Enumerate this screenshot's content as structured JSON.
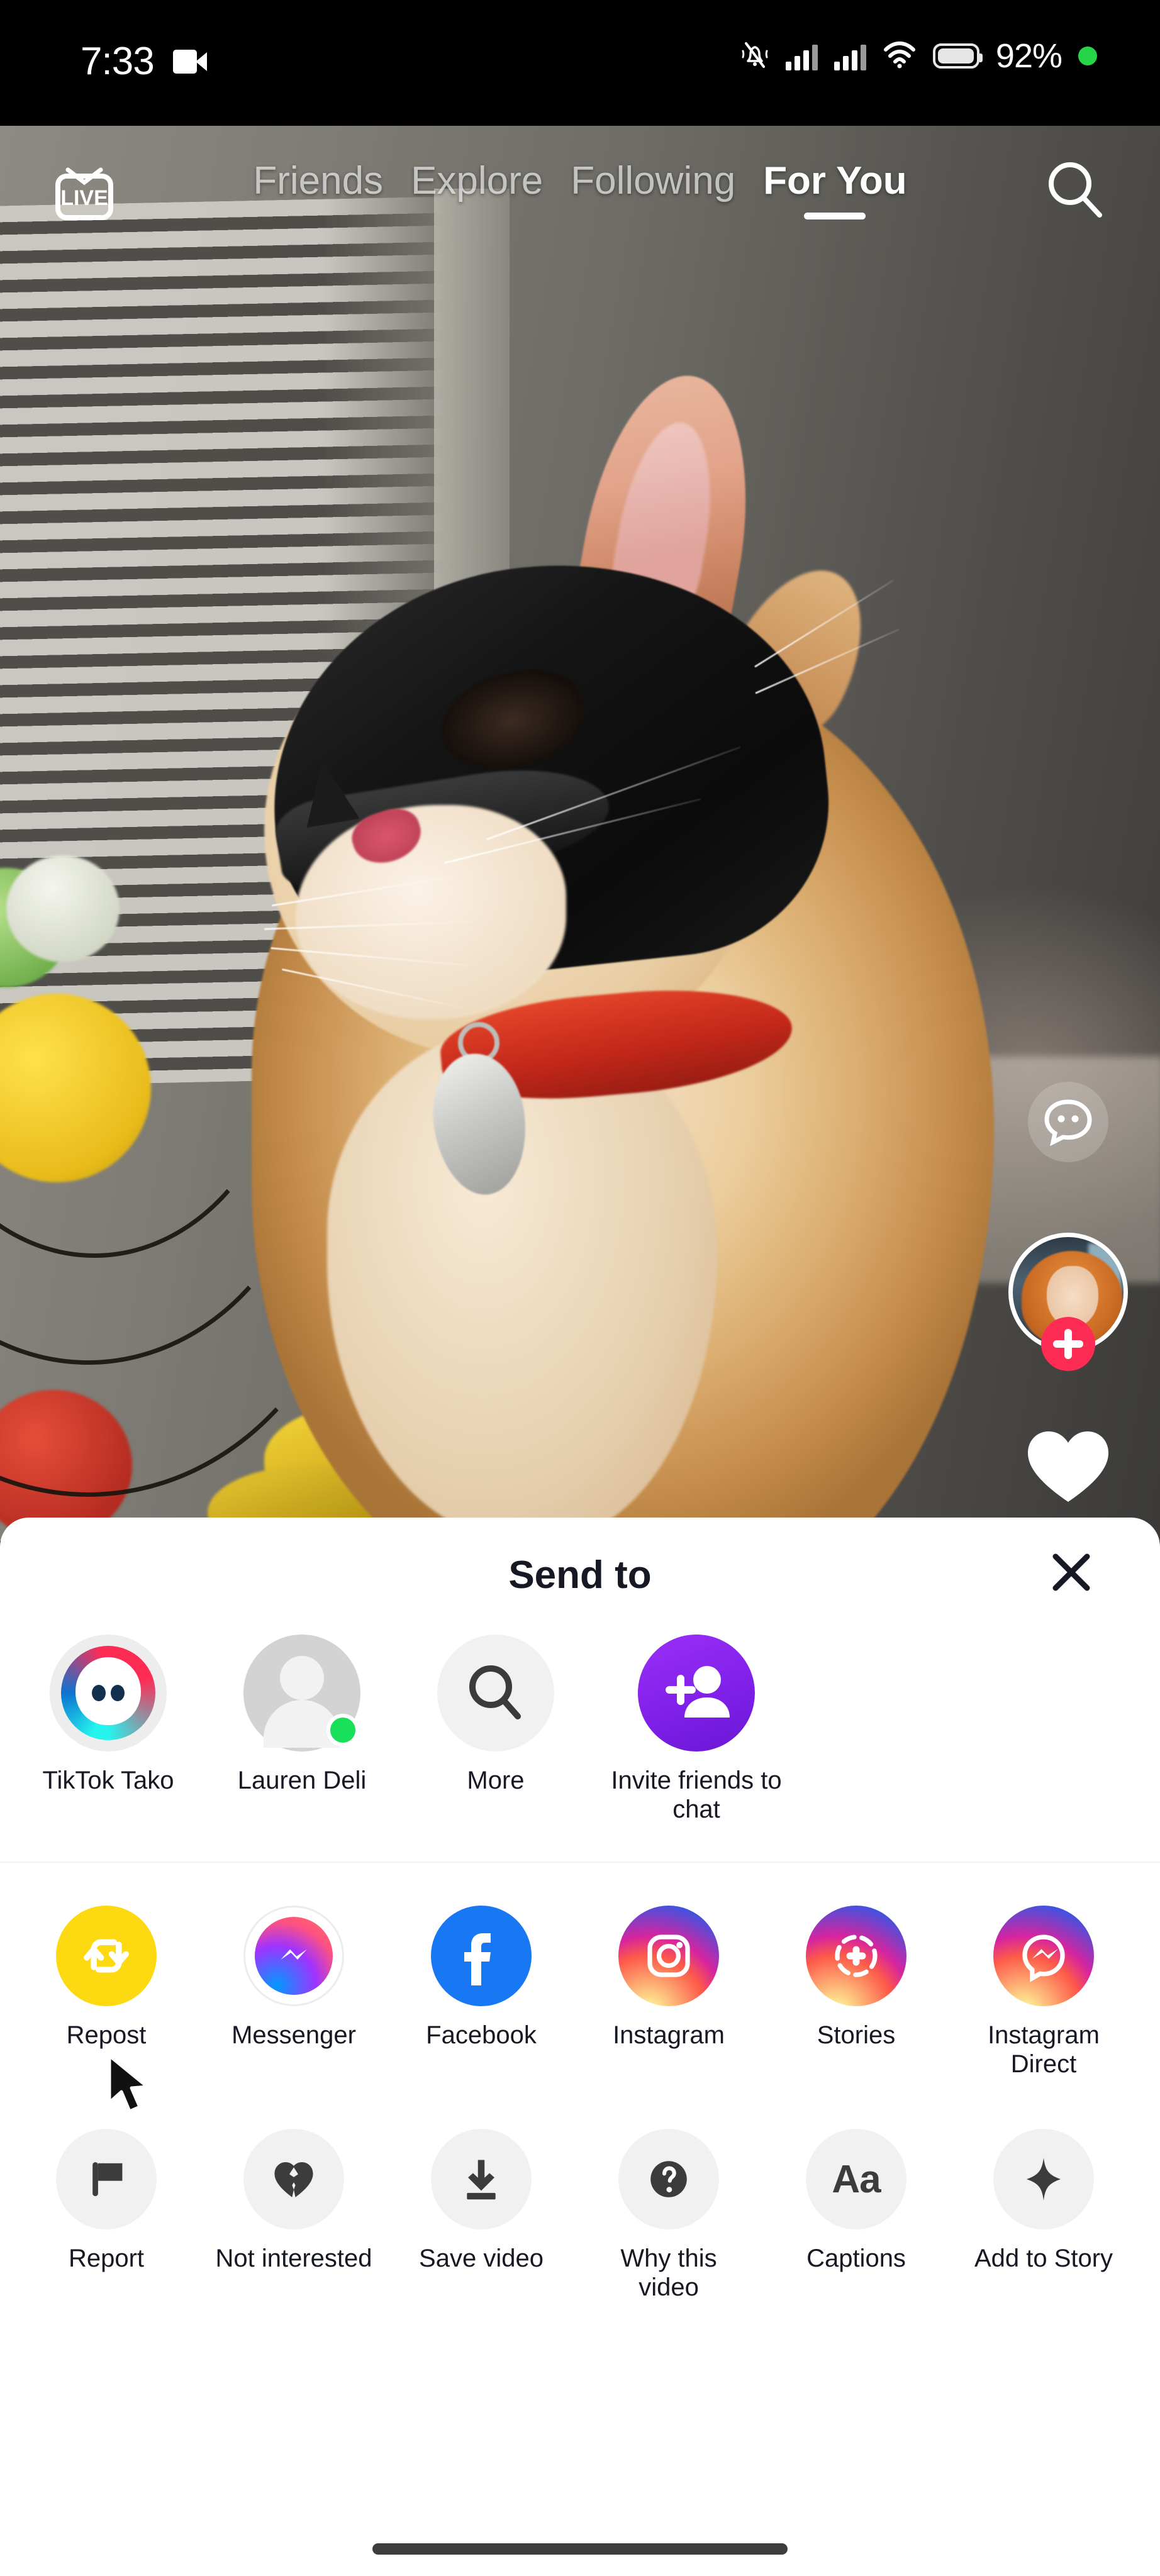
{
  "status_bar": {
    "time": "7:33",
    "battery_percent": "92%",
    "icons": [
      "video-camera-icon",
      "silent-bell-icon",
      "signal-bars-icon",
      "signal-bars-icon",
      "wifi-icon",
      "battery-icon",
      "green-dot-icon"
    ]
  },
  "top_nav": {
    "live_label": "LIVE",
    "tabs": [
      {
        "label": "Friends",
        "active": false
      },
      {
        "label": "Explore",
        "active": false
      },
      {
        "label": "Following",
        "active": false
      },
      {
        "label": "For You",
        "active": true
      }
    ],
    "search_icon": "search-icon"
  },
  "video": {
    "description": "orange tabby cat wearing a black bat mask, red collar with silver tag",
    "actions": {
      "comment_icon": "comment-bubble-icon",
      "follow_badge": "plus-icon",
      "like_icon": "heart-icon"
    }
  },
  "share_sheet": {
    "title": "Send to",
    "close_icon": "close-icon",
    "contacts": [
      {
        "label": "TikTok Tako",
        "icon": "tiktok-tako-avatar",
        "online": false
      },
      {
        "label": "Lauren Deli",
        "icon": "person-avatar",
        "online": true
      },
      {
        "label": "More",
        "icon": "search-icon",
        "online": false
      },
      {
        "label": "Invite friends to chat",
        "icon": "add-person-icon",
        "online": false
      }
    ],
    "apps": [
      {
        "label": "Repost",
        "icon": "repost-icon",
        "color": "#fcd911"
      },
      {
        "label": "Messenger",
        "icon": "messenger-icon",
        "color": "#ffffff"
      },
      {
        "label": "Facebook",
        "icon": "facebook-icon",
        "color": "#1877f2"
      },
      {
        "label": "Instagram",
        "icon": "instagram-icon",
        "color": "#d6249f"
      },
      {
        "label": "Stories",
        "icon": "instagram-stories-icon",
        "color": "#d6249f"
      },
      {
        "label": "Instagram Direct",
        "icon": "instagram-direct-icon",
        "color": "#d6249f"
      }
    ],
    "actions": [
      {
        "label": "Report",
        "icon": "flag-icon"
      },
      {
        "label": "Not interested",
        "icon": "broken-heart-icon"
      },
      {
        "label": "Save video",
        "icon": "download-icon"
      },
      {
        "label": "Why this video",
        "icon": "question-mark-icon"
      },
      {
        "label": "Captions",
        "icon": "text-aa-icon"
      },
      {
        "label": "Add to Story",
        "icon": "sparkle-icon"
      }
    ]
  },
  "colors": {
    "accent_pink": "#fe2c55",
    "accent_cyan": "#25f4ee",
    "facebook_blue": "#1877f2",
    "repost_yellow": "#fcd911",
    "invite_purple": "#8b2ff5",
    "online_green": "#18e05a",
    "text_dark": "#161823"
  },
  "home_indicator": "home-indicator-bar"
}
